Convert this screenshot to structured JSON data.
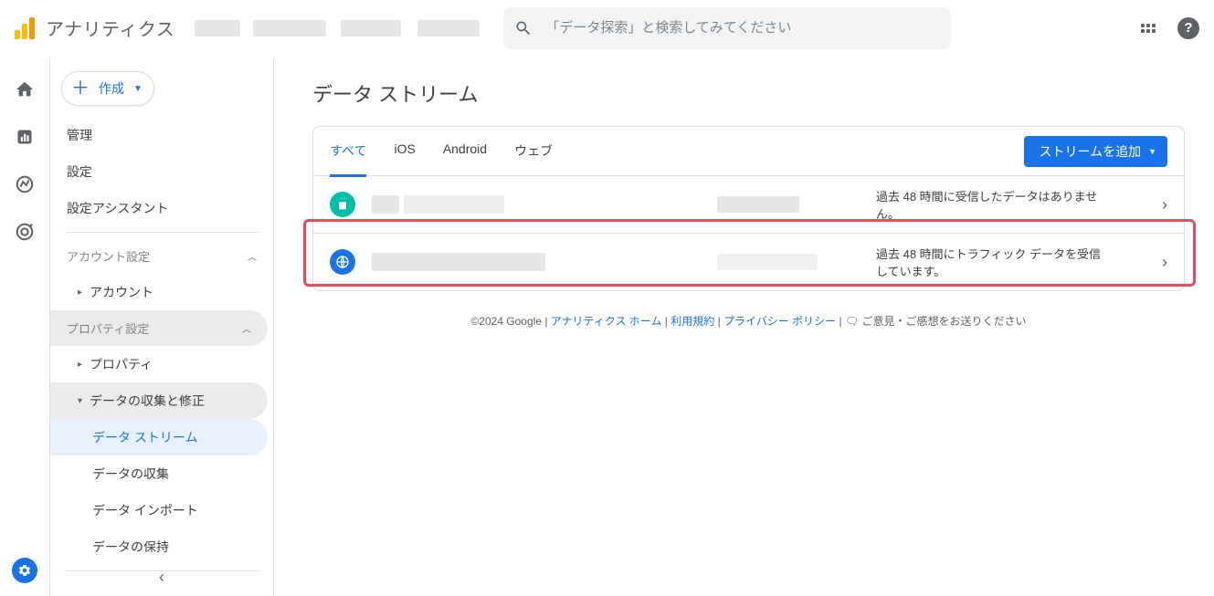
{
  "header": {
    "product_name": "アナリティクス",
    "search_placeholder": "「データ探索」と検索してみてください"
  },
  "create_button": {
    "label": "作成"
  },
  "sidebar": {
    "top": [
      {
        "label": "管理"
      },
      {
        "label": "設定"
      },
      {
        "label": "設定アシスタント"
      }
    ],
    "account_section": "アカウント設定",
    "account_item": "アカウント",
    "property_section": "プロパティ設定",
    "property_item": "プロパティ",
    "data_collection_section": "データの収集と修正",
    "sub_items": [
      "データ ストリーム",
      "データの収集",
      "データ インポート",
      "データの保持"
    ]
  },
  "page": {
    "title": "データ ストリーム"
  },
  "tabs": [
    "すべて",
    "iOS",
    "Android",
    "ウェブ"
  ],
  "add_stream_label": "ストリームを追加",
  "rows": [
    {
      "status": "過去 48 時間に受信したデータはありません。"
    },
    {
      "status": "過去 48 時間にトラフィック データを受信しています。"
    }
  ],
  "footer": {
    "copyright": "©2024 Google",
    "links": [
      "アナリティクス ホーム",
      "利用規約",
      "プライバシー ポリシー"
    ],
    "feedback": "ご意見・ご感想をお送りください"
  }
}
